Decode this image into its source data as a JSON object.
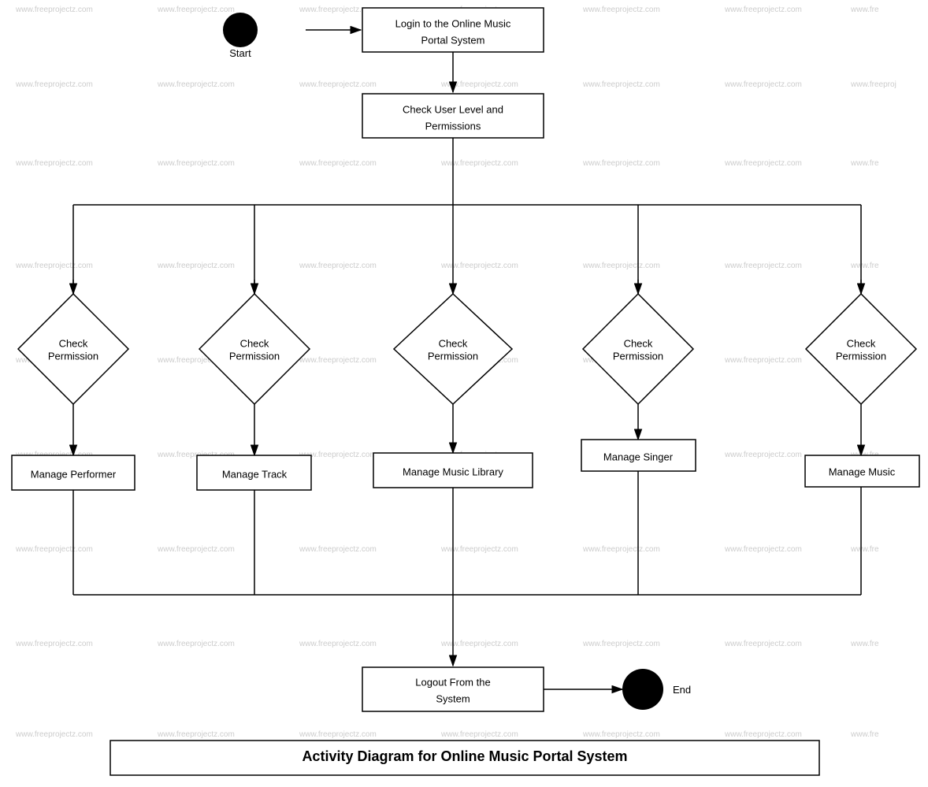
{
  "diagram": {
    "title": "Activity Diagram for Online Music Portal System",
    "nodes": {
      "start": "Start",
      "login": "Login to the Online Music Portal System",
      "check_permissions": "Check User Level and Permissions",
      "check_perm1": "Check Permission",
      "check_perm2": "Check Permission",
      "check_perm3": "Check Permission",
      "check_perm4": "Check Permission",
      "check_perm5": "Check Permission",
      "manage_performer": "Manage Performer",
      "manage_track": "Manage Track",
      "manage_music_library": "Manage Music Library",
      "manage_singer": "Manage Singer",
      "manage_music": "Manage Music",
      "logout": "Logout From the System",
      "end": "End"
    },
    "watermark": "www.freeprojectz.com"
  }
}
